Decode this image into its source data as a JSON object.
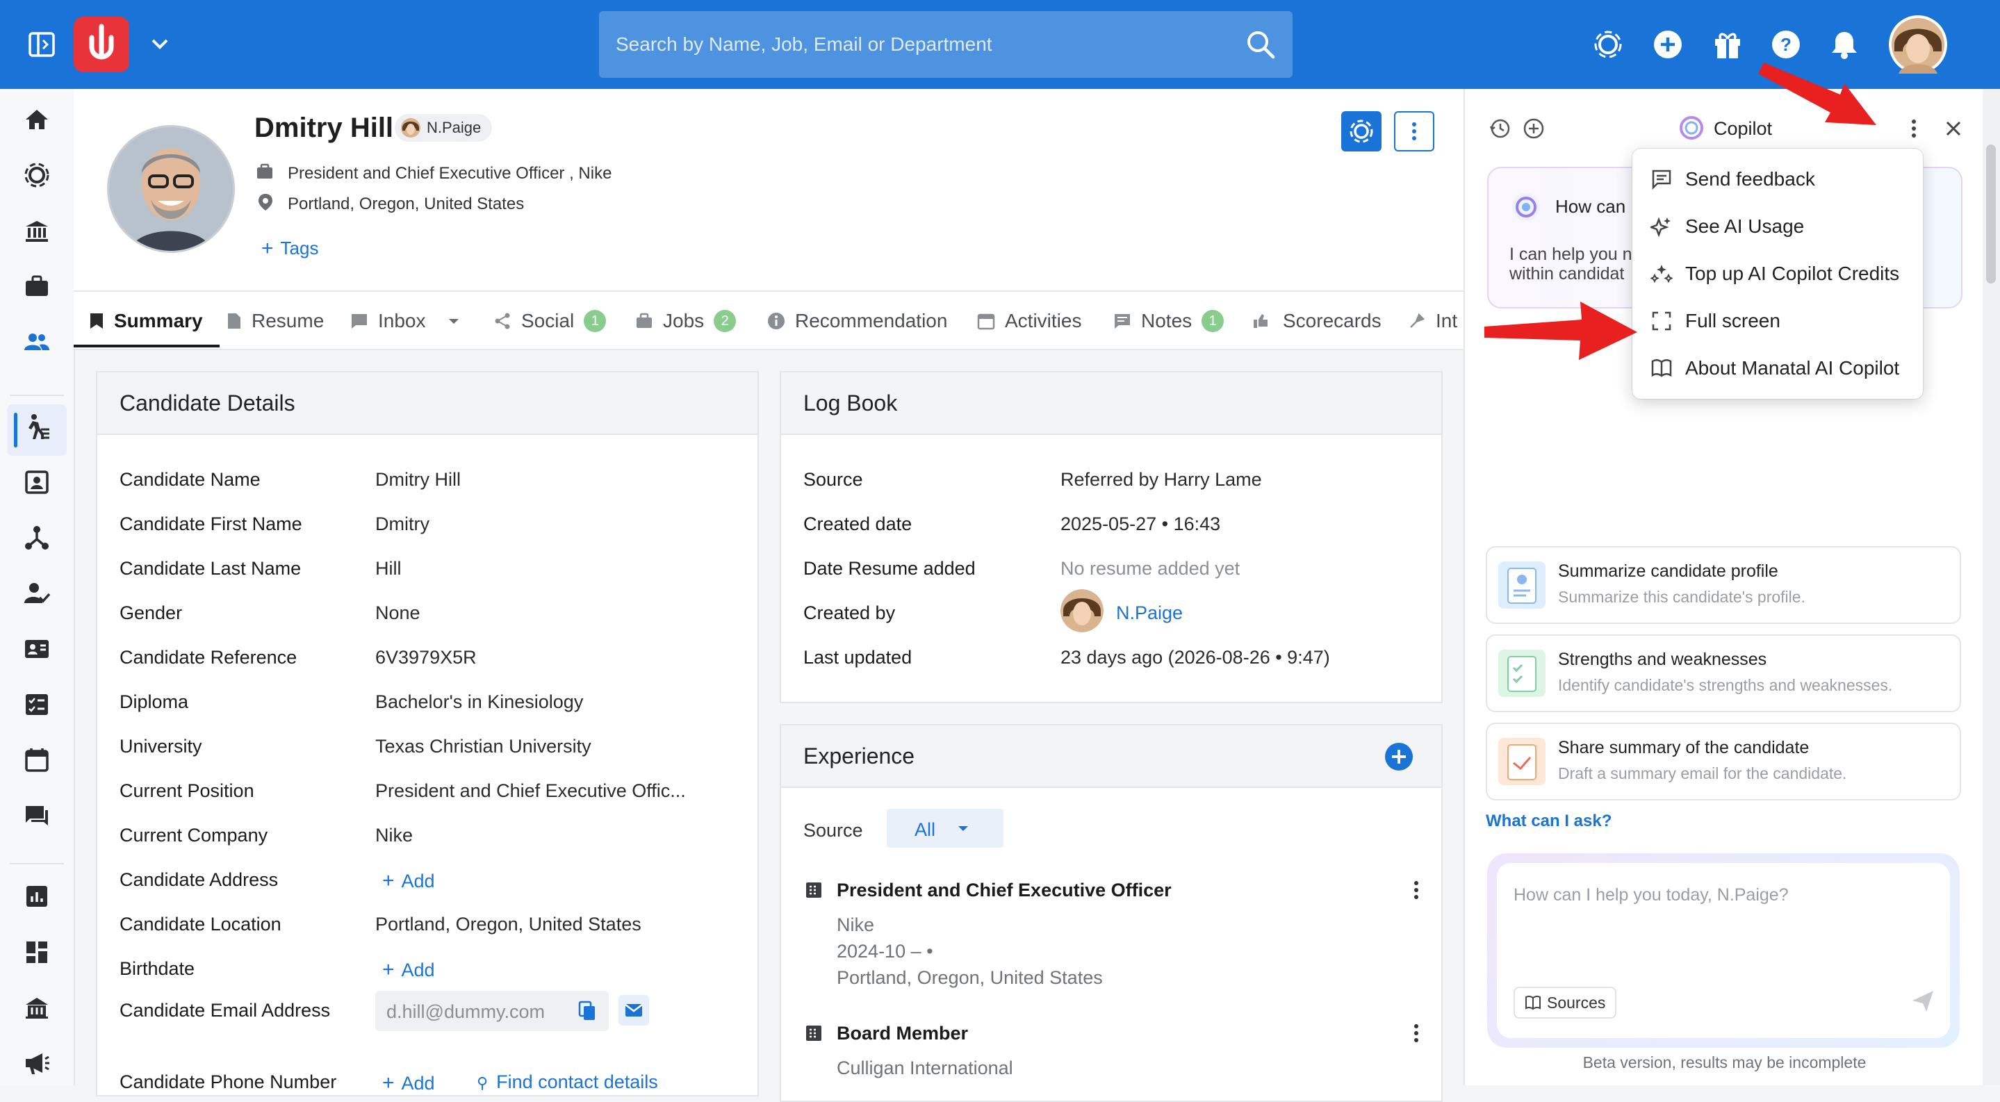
{
  "topbar": {
    "search_placeholder": "Search by Name, Job, Email or Department"
  },
  "profile": {
    "name": "Dmitry Hill",
    "owner": "N.Paige",
    "position": "President and Chief Executive Officer , Nike",
    "location": "Portland, Oregon, United States",
    "tags_label": "Tags"
  },
  "tabs": [
    {
      "label": "Summary"
    },
    {
      "label": "Resume"
    },
    {
      "label": "Inbox"
    },
    {
      "label": "Social",
      "badge": "1"
    },
    {
      "label": "Jobs",
      "badge": "2"
    },
    {
      "label": "Recommendation"
    },
    {
      "label": "Activities"
    },
    {
      "label": "Notes",
      "badge": "1"
    },
    {
      "label": "Scorecards"
    },
    {
      "label": "Int"
    }
  ],
  "candidate_details": {
    "title": "Candidate Details",
    "rows": [
      {
        "label": "Candidate Name",
        "value": "Dmitry Hill"
      },
      {
        "label": "Candidate First Name",
        "value": "Dmitry"
      },
      {
        "label": "Candidate Last Name",
        "value": "Hill"
      },
      {
        "label": "Gender",
        "value": "None"
      },
      {
        "label": "Candidate Reference",
        "value": "6V3979X5R"
      },
      {
        "label": "Diploma",
        "value": "Bachelor's in Kinesiology"
      },
      {
        "label": "University",
        "value": "Texas Christian University"
      },
      {
        "label": "Current Position",
        "value": "President and Chief Executive Offic..."
      },
      {
        "label": "Current Company",
        "value": "Nike"
      },
      {
        "label": "Candidate Address",
        "value": "Add"
      },
      {
        "label": "Candidate Location",
        "value": "Portland, Oregon, United States"
      },
      {
        "label": "Birthdate",
        "value": "Add"
      },
      {
        "label": "Candidate Email Address",
        "value": "d.hill@dummy.com"
      },
      {
        "label": "Candidate Phone Number",
        "value": "Add"
      }
    ],
    "find_contact": "Find contact details"
  },
  "logbook": {
    "title": "Log Book",
    "rows": [
      {
        "label": "Source",
        "value": "Referred by Harry Lame"
      },
      {
        "label": "Created date",
        "value": "2025-05-27 • 16:43"
      },
      {
        "label": "Date Resume added",
        "value": "No resume added yet"
      },
      {
        "label": "Created by",
        "value": "N.Paige"
      },
      {
        "label": "Last updated",
        "value": "23 days ago (2026-08-26 • 9:47)"
      }
    ]
  },
  "experience": {
    "title": "Experience",
    "source_label": "Source",
    "source_value": "All",
    "items": [
      {
        "title": "President and Chief Executive Officer",
        "company": "Nike",
        "dates": "2024-10 – •",
        "location": "Portland, Oregon, United States"
      },
      {
        "title": "Board Member",
        "company": "Culligan International"
      }
    ]
  },
  "copilot": {
    "title": "Copilot",
    "greeting_title": "How can I",
    "greeting_body_1": "I can help you n",
    "greeting_body_2": "within candidat",
    "menu": [
      {
        "label": "Send feedback",
        "icon": "feedback-icon"
      },
      {
        "label": "See AI Usage",
        "icon": "sparkle-icon"
      },
      {
        "label": "Top up AI Copilot Credits",
        "icon": "credits-icon"
      },
      {
        "label": "Full screen",
        "icon": "fullscreen-icon"
      },
      {
        "label": "About Manatal AI Copilot",
        "icon": "book-icon"
      }
    ],
    "suggestions": [
      {
        "title": "Summarize candidate profile",
        "desc": "Summarize this candidate's profile."
      },
      {
        "title": "Strengths and weaknesses",
        "desc": "Identify candidate's strengths and weaknesses."
      },
      {
        "title": "Share summary of the candidate",
        "desc": "Draft a summary email for the candidate."
      }
    ],
    "what_can_i_ask": "What can I ask?",
    "input_placeholder": "How can I help you today, N.Paige?",
    "sources_label": "Sources",
    "beta_note": "Beta version, results may be incomplete"
  },
  "colors": {
    "brand": "#1a73d6",
    "logo_red": "#e8333b",
    "badge_green": "#88cc8e",
    "annotation_arrow": "#e8201f"
  }
}
